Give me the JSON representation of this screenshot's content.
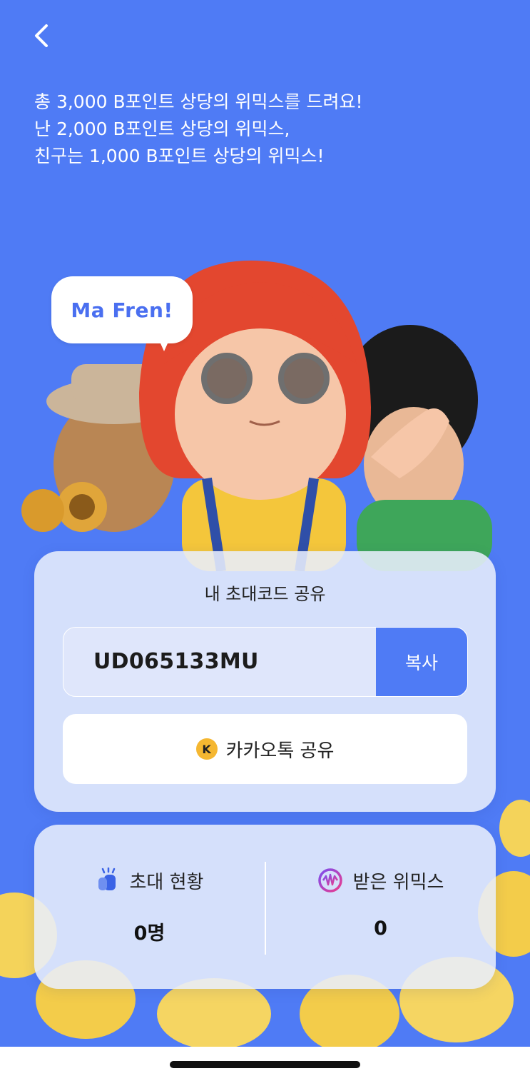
{
  "nav": {
    "back_icon": "chevron-left-icon"
  },
  "headline": {
    "lines": [
      "총 3,000 B포인트 상당의 위믹스를 드려요!",
      "난 2,000 B포인트 상당의 위믹스,",
      "친구는 1,000 B포인트 상당의 위믹스!"
    ]
  },
  "hero": {
    "speech_bubble": "Ma Fren!"
  },
  "invite": {
    "title": "내 초대코드 공유",
    "code": "UD065133MU",
    "copy_label": "복사",
    "kakao_icon_letter": "K",
    "kakao_label": "카카오톡 공유"
  },
  "stats": {
    "invite_status_label": "초대 현황",
    "invite_status_value": "0명",
    "received_label": "받은 위믹스",
    "received_value": "0"
  },
  "colors": {
    "background": "#4f7bf5",
    "accent": "#4f7bf5",
    "kakao": "#f5b731"
  }
}
